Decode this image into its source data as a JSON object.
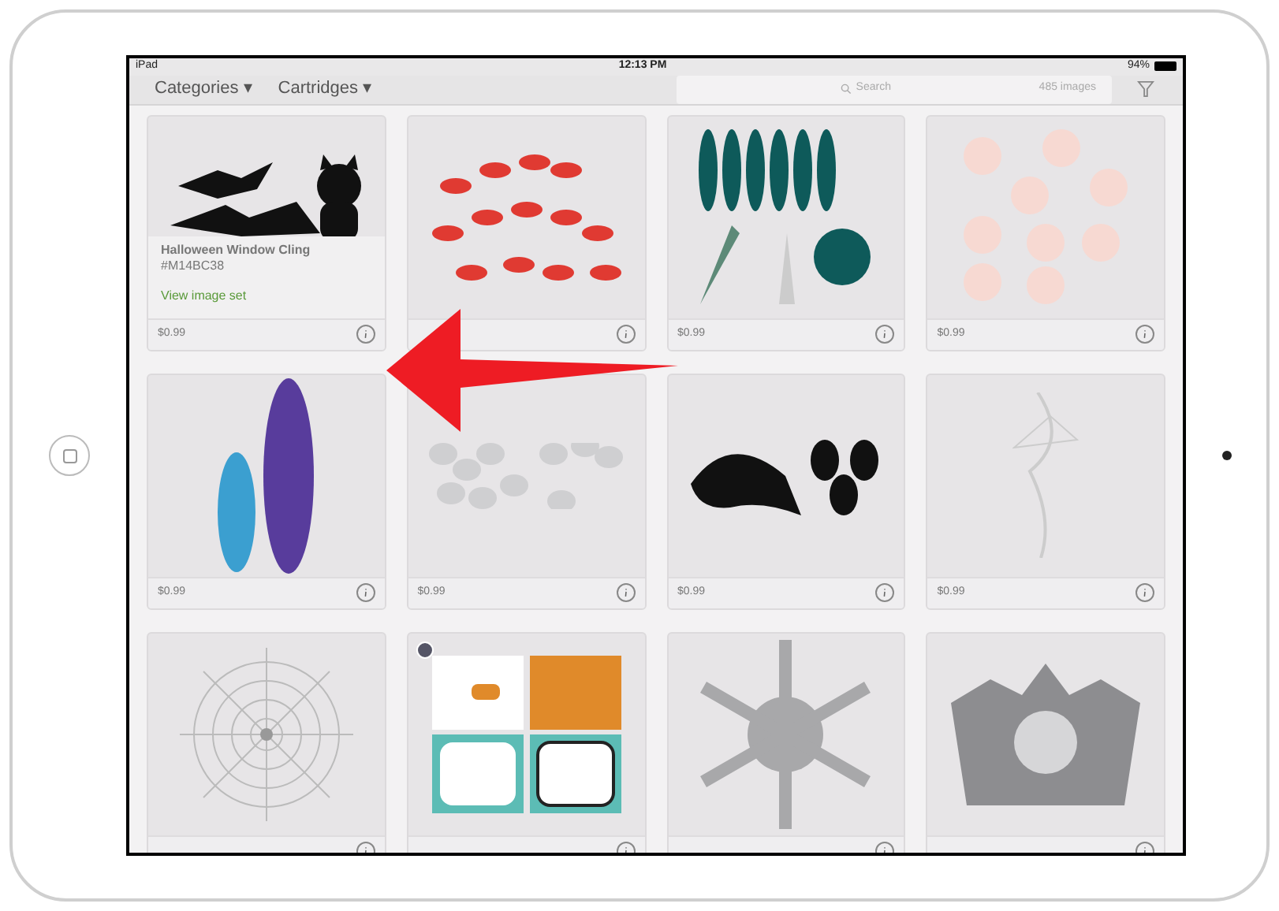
{
  "status_bar": {
    "device": "iPad",
    "time": "12:13 PM",
    "battery": "94%"
  },
  "toolbar": {
    "menus": [
      "Categories ▾",
      "Cartridges ▾"
    ],
    "search": {
      "placeholder": "Search",
      "count": "485 images"
    }
  },
  "cards": [
    {
      "kind": "bats",
      "price": "$0.99",
      "details": {
        "title": "Halloween Window Cling",
        "code": "#M14BC38",
        "link": "View image set"
      }
    },
    {
      "kind": "fish"
    },
    {
      "kind": "leaves",
      "price": "$0.99"
    },
    {
      "kind": "stars",
      "price": "$0.99"
    },
    {
      "kind": "feathers",
      "price": "$0.99"
    },
    {
      "kind": "animals",
      "price": "$0.99"
    },
    {
      "kind": "orca",
      "price": "$0.99"
    },
    {
      "kind": "witch",
      "price": "$0.99"
    },
    {
      "kind": "web"
    },
    {
      "kind": "cards",
      "badge": true
    },
    {
      "kind": "snowflake"
    },
    {
      "kind": "crown"
    }
  ]
}
